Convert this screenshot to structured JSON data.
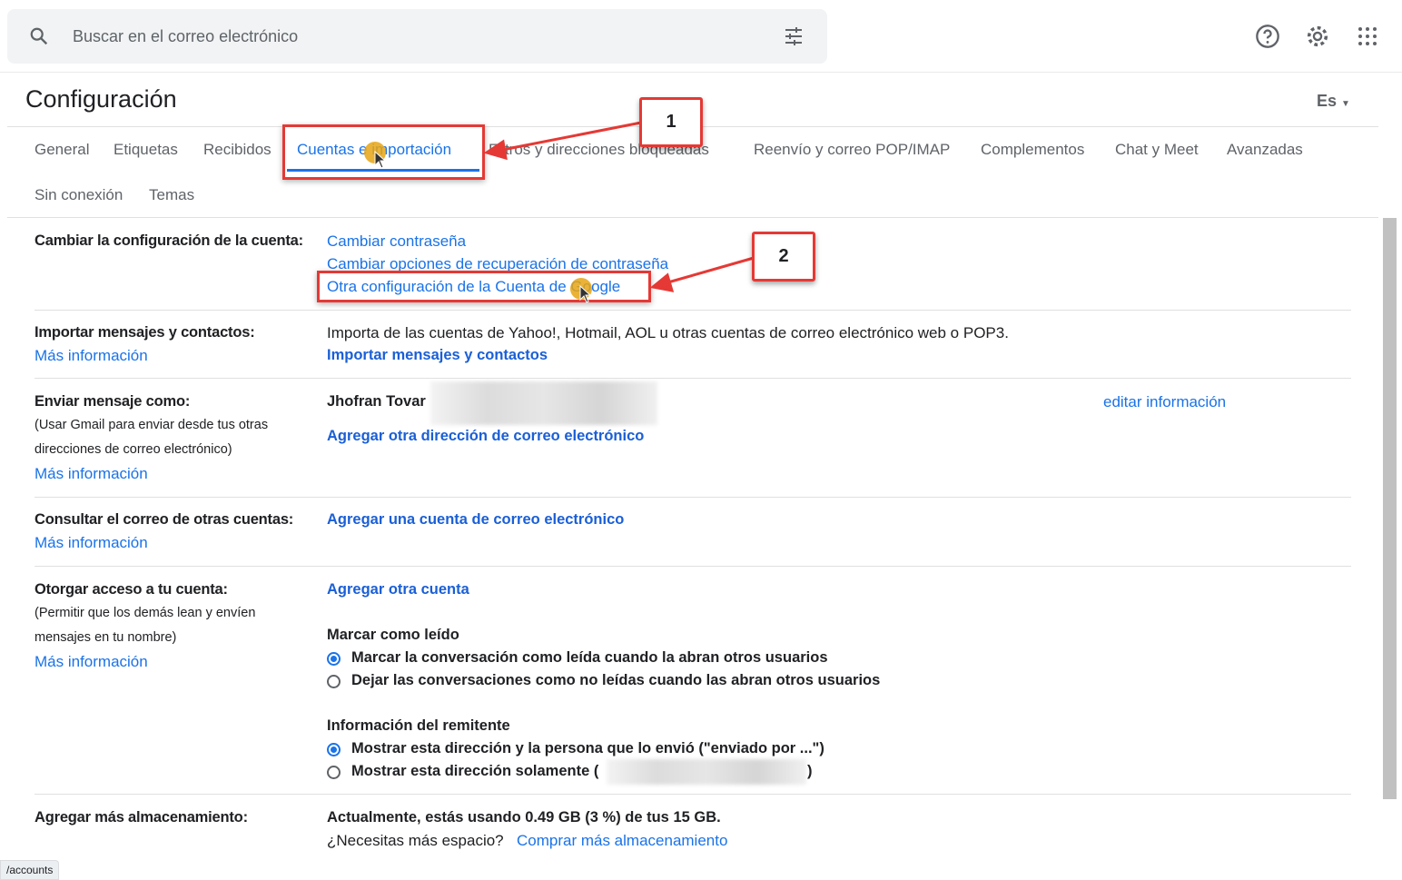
{
  "search": {
    "placeholder": "Buscar en el correo electrónico"
  },
  "header": {
    "title": "Configuración",
    "lang": "Es"
  },
  "tabs": [
    "General",
    "Etiquetas",
    "Recibidos",
    "Cuentas e importación",
    "Filtros y direcciones bloqueadas",
    "Reenvío y correo POP/IMAP",
    "Complementos",
    "Chat y Meet",
    "Avanzadas",
    "Sin conexión",
    "Temas"
  ],
  "active_tab": "Cuentas e importación",
  "sections": {
    "account": {
      "label": "Cambiar la configuración de la cuenta:",
      "links": [
        "Cambiar contraseña",
        "Cambiar opciones de recuperación de contraseña",
        "Otra configuración de la Cuenta de Google"
      ]
    },
    "import": {
      "label": "Importar mensajes y contactos:",
      "more": "Más información",
      "desc": "Importa de las cuentas de Yahoo!, Hotmail, AOL u otras cuentas de correo electrónico web o POP3.",
      "action": "Importar mensajes y contactos"
    },
    "sendas": {
      "label": "Enviar mensaje como:",
      "sub1": "(Usar Gmail para enviar desde tus otras",
      "sub2": "direcciones de correo electrónico)",
      "more": "Más información",
      "name": "Jhofran Tovar",
      "edit": "editar información",
      "action": "Agregar otra dirección de correo electrónico"
    },
    "check": {
      "label": "Consultar el correo de otras cuentas:",
      "more": "Más información",
      "action": "Agregar una cuenta de correo electrónico"
    },
    "grant": {
      "label": "Otorgar acceso a tu cuenta:",
      "sub1": "(Permitir que los demás lean y envíen",
      "sub2": "mensajes en tu nombre)",
      "more": "Más información",
      "action": "Agregar otra cuenta",
      "read_title": "Marcar como leído",
      "read_opts": [
        "Marcar la conversación como leída cuando la abran otros usuarios",
        "Dejar las conversaciones como no leídas cuando las abran otros usuarios"
      ],
      "sender_title": "Información del remitente",
      "sender_opts": [
        "Mostrar esta dirección y la persona que lo envió (\"enviado por ...\")",
        "Mostrar esta dirección solamente ("
      ],
      "sender_close": ")"
    },
    "storage": {
      "label": "Agregar más almacenamiento:",
      "usage": "Actualmente, estás usando 0.49 GB (3 %) de tus 15 GB.",
      "need": "¿Necesitas más espacio?",
      "buy": "Comprar más almacenamiento"
    }
  },
  "annotations": {
    "callout1": "1",
    "callout2": "2"
  },
  "status_url": "/accounts",
  "colors": {
    "accent": "#1a73e8",
    "annotation": "#e53935"
  }
}
